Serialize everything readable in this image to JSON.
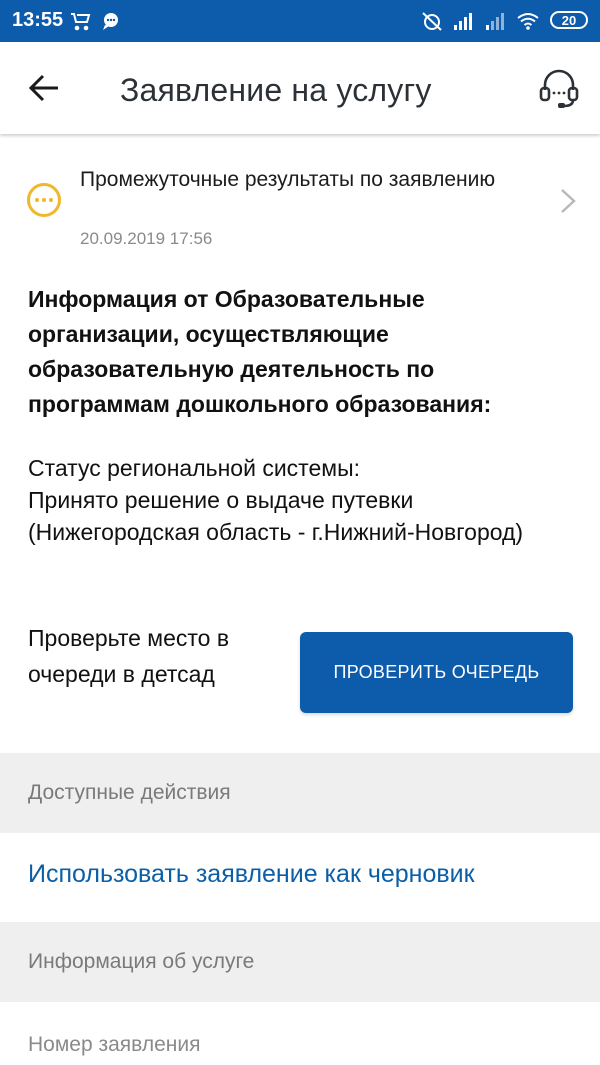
{
  "status_bar": {
    "time": "13:55",
    "battery": "20",
    "icons": [
      "stroller-icon",
      "chat-icon",
      "alarm-off-icon",
      "signal-icon",
      "signal-weak-icon",
      "wifi-icon",
      "battery-icon"
    ]
  },
  "app_bar": {
    "title": "Заявление на услугу",
    "back_icon": "arrow-left-icon",
    "support_icon": "headset-icon"
  },
  "result": {
    "title": "Промежуточные результаты по заявлению",
    "date": "20.09.2019 17:56",
    "icon": "more-dots-icon",
    "icon_color": "#f0b72a"
  },
  "info": {
    "heading": "Информация от Образовательные организации, осуществляющие образовательную деятельность по программам дошкольного образования:",
    "status": "Статус региональной системы:\nПринято решение о выдаче путевки (Нижегородская область - г.Нижний-Новгород)"
  },
  "queue": {
    "text": "Проверьте место в очереди в детсад",
    "button_label": "ПРОВЕРИТЬ ОЧЕРЕДЬ"
  },
  "sections": {
    "available_actions": "Доступные действия",
    "use_as_draft": "Использовать заявление как черновик",
    "service_info": "Информация об услуге",
    "application_number": "Номер заявления"
  },
  "colors": {
    "primary": "#0d5bab",
    "link": "#0b5fa8",
    "section_bg": "#efefef",
    "accent": "#f0b72a"
  }
}
